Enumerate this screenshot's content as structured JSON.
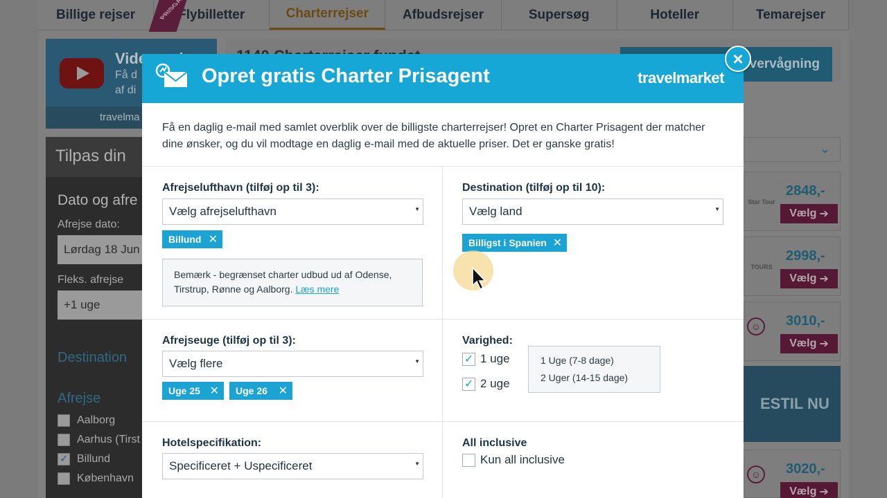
{
  "topnav": {
    "tabs": [
      {
        "label": "Billige rejser"
      },
      {
        "label": "Flybilletter"
      },
      {
        "label": "Charterrejser"
      },
      {
        "label": "Afbudsrejser"
      },
      {
        "label": "Supersøg"
      },
      {
        "label": "Hoteller"
      },
      {
        "label": "Temarejser"
      }
    ],
    "ribbon": "PRISGA"
  },
  "video_box": {
    "title": "Video gui",
    "sub1": "Få d",
    "sub2": "af di",
    "brand": "travelma"
  },
  "result_header": {
    "title": "1140 Charterrejser fundet",
    "watch_button": "vervågning"
  },
  "left_panel": {
    "header": "Tilpas din",
    "date_title": "Dato og afre",
    "departure_label": "Afrejse dato:",
    "departure_value": "Lørdag 18 Jun",
    "flex_label": "Fleks. afrejse",
    "flex_value": "+1 uge",
    "destination_link": "Destination",
    "departure_link": "Afrejse",
    "airports": [
      {
        "label": "Aalborg",
        "checked": false
      },
      {
        "label": "Aarhus (Tirst",
        "checked": false
      },
      {
        "label": "Billund",
        "checked": true
      },
      {
        "label": "København",
        "checked": false
      }
    ]
  },
  "results": [
    {
      "logo": "Star Tour",
      "price": "2848,-",
      "button": "Vælg"
    },
    {
      "logo": "TOURS",
      "price": "2998,-",
      "button": "Vælg"
    },
    {
      "logo": "",
      "price": "3010,-",
      "button": "Vælg"
    },
    {
      "logo": "",
      "price": "3020,-",
      "button": "Vælg"
    }
  ],
  "promo": {
    "text": "ESTIL NU"
  },
  "modal": {
    "title": "Opret gratis Charter Prisagent",
    "brand": "travelmarket",
    "close": "×",
    "intro": "Få en daglig e-mail med samlet overblik over de billigste charterrejser! Opret en Charter Prisagent der matcher dine ønsker, og du vil modtage en daglig e-mail med de aktuelle priser. Det er ganske gratis!",
    "departure_airport": {
      "label": "Afrejselufthavn (tilføj op til 3):",
      "select": "Vælg afrejselufthavn",
      "tags": [
        "Billund"
      ],
      "note": "Bemærk - begrænset charter udbud ud af Odense, Tirstrup, Rønne og Aalborg.",
      "note_link": "Læs mere"
    },
    "destination": {
      "label": "Destination (tilføj op til 10):",
      "select": "Vælg land",
      "tags": [
        "Billigst i Spanien"
      ]
    },
    "departure_week": {
      "label": "Afrejseuge (tilføj op til 3):",
      "select": "Vælg flere",
      "tags": [
        "Uge 25",
        "Uge 26"
      ]
    },
    "duration": {
      "label": "Varighed:",
      "options": [
        {
          "label": "1 uge",
          "checked": true
        },
        {
          "label": "2 uge",
          "checked": true
        }
      ],
      "info": [
        "1 Uge (7-8 dage)",
        "2 Uger (14-15 dage)"
      ]
    },
    "hotel": {
      "label": "Hotelspecifikation:",
      "select": "Specificeret + Uspecificeret"
    },
    "all_inclusive": {
      "label": "All inclusive",
      "option": "Kun all inclusive",
      "checked": false
    }
  }
}
